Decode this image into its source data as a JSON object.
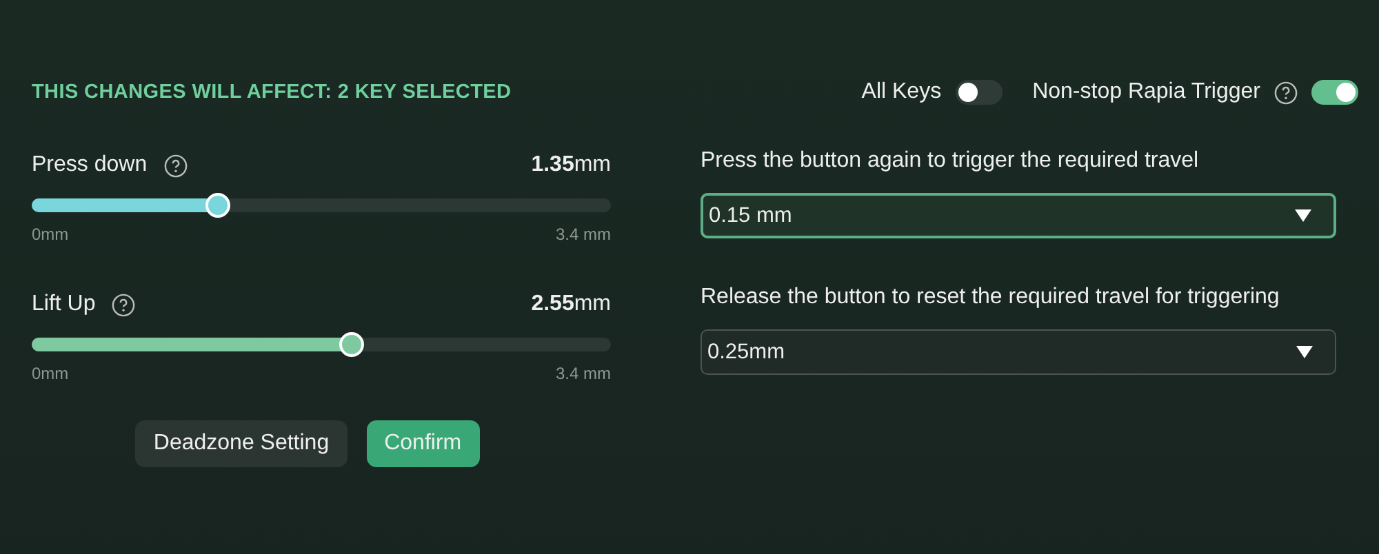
{
  "header": {
    "title": "THIS CHANGES WILL AFFECT: 2 KEY SELECTED"
  },
  "toggles": [
    {
      "label": "All Keys",
      "help": false,
      "on": false
    },
    {
      "label": "Non-stop Rapia Trigger",
      "help": true,
      "on": true
    }
  ],
  "sliders": [
    {
      "label": "Press down",
      "value": "**1.35**mm",
      "level": 0.32,
      "color": "#79d6dc",
      "min": "0mm",
      "max": "3.4 mm"
    },
    {
      "label": "Lift Up",
      "value": "**2.55**mm",
      "level": 0.55,
      "color": "#7fc9a1",
      "min": "0mm",
      "max": "3.4 mm"
    }
  ],
  "buttons": [
    {
      "label": "Deadzone Setting",
      "kind": "secondary"
    },
    {
      "label": "Confirm",
      "kind": "primary"
    }
  ],
  "dropdowns": [
    {
      "label": "Press the button again to trigger the required travel",
      "value": "0.15 mm",
      "focused": true
    },
    {
      "label": "Release the button to reset the required travel for triggering",
      "value": "0.25mm",
      "focused": false
    }
  ]
}
